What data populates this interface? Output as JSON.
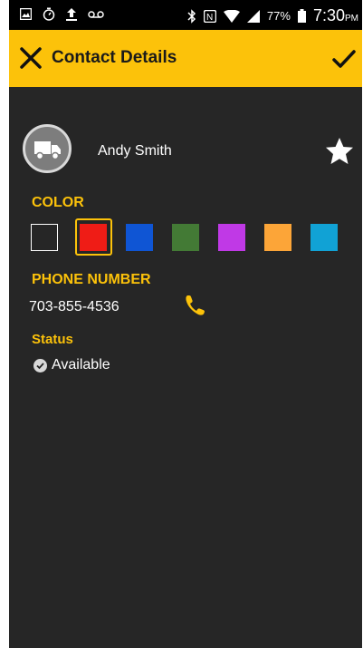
{
  "status_bar": {
    "battery_percent": "77%",
    "time": "7:30",
    "ampm": "PM"
  },
  "header": {
    "title": "Contact Details",
    "background": "#fcc20a"
  },
  "contact": {
    "name": "Andy Smith",
    "avatar_icon": "truck-icon",
    "favorite_icon": "star-icon"
  },
  "color_section": {
    "label": "COLOR",
    "swatches": [
      "#262626",
      "#ef1c16",
      "#0f55d4",
      "#437a35",
      "#c039e6",
      "#fca538",
      "#11a2d5"
    ],
    "selected_index": 1
  },
  "phone_section": {
    "label": "PHONE NUMBER",
    "number": "703-855-4536",
    "call_icon": "phone-icon"
  },
  "status_section": {
    "label": "Status",
    "value": "Available",
    "status_icon": "check-circle-icon"
  }
}
